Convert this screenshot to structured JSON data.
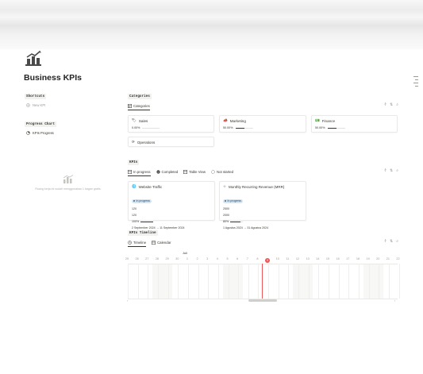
{
  "page": {
    "title": "Business KPIs",
    "icon": "chart-bars-icon"
  },
  "shortcuts": {
    "label": "Shortcuts",
    "items": [
      {
        "label": "New KPI",
        "icon": "plus-circle-icon"
      }
    ]
  },
  "progress_chart": {
    "label": "Progress Chart",
    "items": [
      {
        "label": "KPIs Progress",
        "icon": "pie-chart-icon"
      }
    ],
    "empty_message": "Ruang kerja ini sudah menggunakan 1 bagan gratis."
  },
  "categories": {
    "label": "Categories",
    "view_tab": "Categories",
    "cards": [
      {
        "name": "Sales",
        "icon": "tag-icon",
        "progress": "0.00%",
        "fraction": 0.0
      },
      {
        "name": "Marketing",
        "icon": "megaphone-icon",
        "progress": "50.00%",
        "fraction": 0.5
      },
      {
        "name": "Finance",
        "icon": "banknote-icon",
        "progress": "50.00%",
        "fraction": 0.5
      },
      {
        "name": "Operations",
        "icon": "refresh-icon"
      }
    ]
  },
  "kpis": {
    "label": "KPIs",
    "tabs": [
      {
        "label": "In progress",
        "icon": "table-icon",
        "active": true
      },
      {
        "label": "Completed",
        "icon": "check-circle-icon",
        "active": false
      },
      {
        "label": "Table View",
        "icon": "table-icon",
        "active": false
      },
      {
        "label": "Not started",
        "icon": "circle-dashed-icon",
        "active": false
      }
    ],
    "cards": [
      {
        "title": "Website Traffic",
        "icon": "globe-icon",
        "status": "In progress",
        "target": "120",
        "current": "120",
        "progress": "100%",
        "fraction": 1.0,
        "dates": "2 September 2024 → 11 September 2024"
      },
      {
        "title": "Monthly Recurring Revenue (MRR)",
        "icon": "star-icon",
        "status": "In progress",
        "target": "2500",
        "current": "2000",
        "progress": "80%",
        "fraction": 0.8,
        "dates": "1 Agustus 2024 → 31 Agustus 2024"
      }
    ]
  },
  "timeline": {
    "label": "KPIs Timeline",
    "tabs": [
      {
        "label": "Timeline",
        "icon": "clock-icon",
        "active": true
      },
      {
        "label": "Calendar",
        "icon": "calendar-icon",
        "active": false
      }
    ],
    "month": "Juli",
    "days": [
      "25",
      "26",
      "27",
      "28",
      "29",
      "30",
      "1",
      "2",
      "3",
      "4",
      "5",
      "6",
      "7",
      "8",
      "9",
      "10",
      "11",
      "12",
      "13",
      "14",
      "15",
      "16",
      "17",
      "18",
      "19",
      "20",
      "21",
      "22"
    ],
    "today": "9"
  },
  "toolbar_icons": [
    "filter-icon",
    "sort-icon",
    "search-icon"
  ],
  "colors": {
    "today": "#eb5757",
    "status_badge_bg": "#d3e5ef",
    "status_badge_text": "#28456c"
  }
}
